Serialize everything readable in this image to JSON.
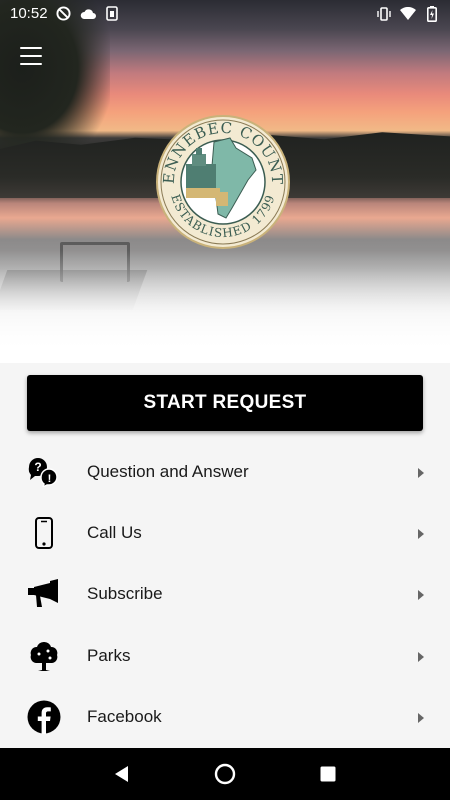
{
  "status_bar": {
    "time": "10:52",
    "icons_left": [
      "do-not-disturb-icon",
      "cloud-icon",
      "sim-icon"
    ],
    "icons_right": [
      "vibrate-icon",
      "wifi-icon",
      "battery-icon"
    ]
  },
  "hero": {
    "seal_top_text": "KENNEBEC COUNTY",
    "seal_bottom_text": "ESTABLISHED 1799"
  },
  "primary_action": {
    "label": "START REQUEST"
  },
  "menu": {
    "items": [
      {
        "label": "Question and Answer",
        "icon": "question-bubbles-icon"
      },
      {
        "label": "Call Us",
        "icon": "phone-icon"
      },
      {
        "label": "Subscribe",
        "icon": "megaphone-icon"
      },
      {
        "label": "Parks",
        "icon": "tree-icon"
      },
      {
        "label": "Facebook",
        "icon": "facebook-icon"
      }
    ]
  },
  "colors": {
    "button_bg": "#000000",
    "list_bg": "#f5f5f5",
    "seal_teal": "#7fb8a8",
    "seal_gold": "#d4b774"
  }
}
